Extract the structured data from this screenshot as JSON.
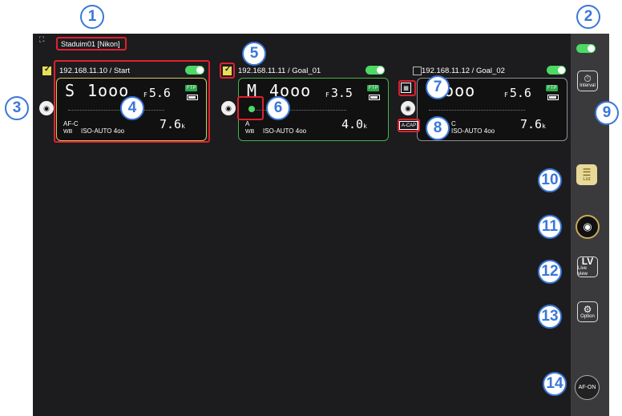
{
  "callouts": [
    "1",
    "2",
    "3",
    "4",
    "5",
    "6",
    "7",
    "8",
    "9",
    "10",
    "11",
    "12",
    "13",
    "14"
  ],
  "header": {
    "group_icon": "⛶",
    "group_name": "Staduim01 [Nikon]"
  },
  "cameras": [
    {
      "label": "192.168.11.10 / Start",
      "checked": true,
      "mode": "S",
      "shutter": "1ooo",
      "aperture_prefix": "F",
      "aperture": "5.6",
      "af": "AF-C",
      "iso": "ISO-AUTO 4oo",
      "shots": "7.6",
      "shots_unit": "k",
      "ftp": "FTP",
      "wb": "WB",
      "border": "#d4c95e"
    },
    {
      "label": "192.168.11.11 / Goal_01",
      "checked": true,
      "mode": "M",
      "shutter": "4ooo",
      "aperture_prefix": "F",
      "aperture": "3.5",
      "af": "A",
      "iso": "ISO-AUTO 4oo",
      "shots": "4.0",
      "shots_unit": "k",
      "ftp": "FTP",
      "wb": "WB",
      "border": "#48b04f"
    },
    {
      "label": "192.168.11.12 / Goal_02",
      "checked": false,
      "mode": "",
      "shutter": "1ooo",
      "aperture_prefix": "F",
      "aperture": "5.6",
      "af": "C",
      "iso": "ISO-AUTO 4oo",
      "shots": "7.6",
      "shots_unit": "k",
      "ftp": "FTP",
      "wb": "",
      "border": "#8e8e8e",
      "acap": "A-CAP"
    }
  ],
  "sidebar": {
    "interval_label": "Interval",
    "list_label": "List",
    "lv_main": "LV",
    "lv_label": "Live view",
    "option_label": "Option",
    "afon_label": "AF-ON"
  },
  "icons": {
    "camera": "camera-icon",
    "gear": "gear-icon",
    "list": "list-icon",
    "timer": "timer-icon"
  }
}
